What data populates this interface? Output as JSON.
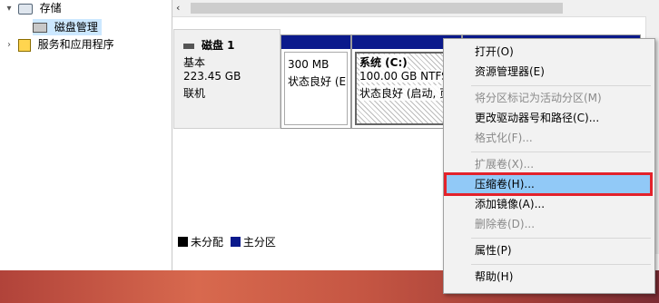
{
  "tree": {
    "storage": "存储",
    "disk_mgmt": "磁盘管理",
    "services": "服务和应用程序"
  },
  "disk": {
    "name": "磁盘 1",
    "type": "基本",
    "size": "223.45 GB",
    "status": "联机"
  },
  "partitions": [
    {
      "size": "300 MB",
      "status": "状态良好 (E"
    },
    {
      "name": "系统  (C:)",
      "size": "100.00 GB NTFS",
      "status": "状态良好 (启动, 页"
    },
    {
      "size": "",
      "status": ""
    }
  ],
  "legend": {
    "unallocated": "未分配",
    "primary": "主分区"
  },
  "colors": {
    "primary_bar": "#0b1a8c",
    "highlight": "#91c9f7",
    "focus_frame": "#e3222b"
  },
  "menu": {
    "open": "打开(O)",
    "explorer": "资源管理器(E)",
    "mark_active": "将分区标记为活动分区(M)",
    "change_letter": "更改驱动器号和路径(C)...",
    "format": "格式化(F)...",
    "extend": "扩展卷(X)...",
    "shrink": "压缩卷(H)...",
    "add_mirror": "添加镜像(A)...",
    "delete": "删除卷(D)...",
    "properties": "属性(P)",
    "help": "帮助(H)"
  }
}
